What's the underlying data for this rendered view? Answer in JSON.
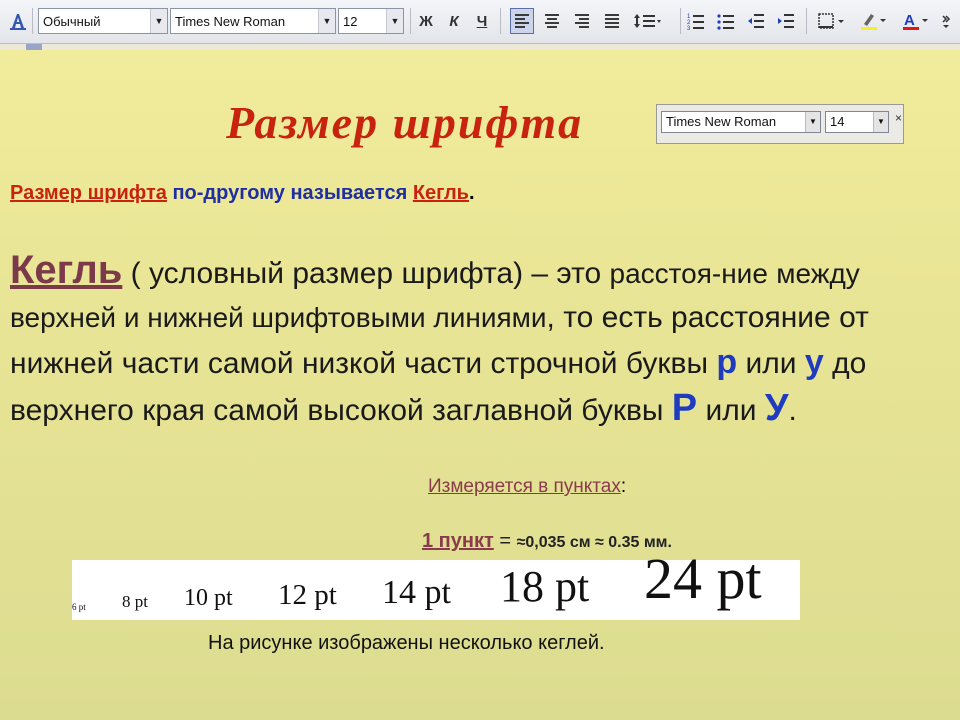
{
  "toolbar": {
    "style_value": "Обычный",
    "font_value": "Times New Roman",
    "size_value": "12",
    "bold_label": "Ж",
    "italic_label": "К",
    "underline_label": "Ч"
  },
  "slide": {
    "title": "Размер шрифта",
    "minibar": {
      "font_value": "Times New Roman",
      "size_value": "14"
    },
    "line1": {
      "term": "Размер шрифта",
      "middle": " по-другому называется ",
      "kegl": "Кегль",
      "end": "."
    },
    "definition": {
      "term": "Кегль",
      "part1": " ( условный размер шрифта) – это ",
      "part1_small": "расстоя-ние",
      "part2": "между верхней и нижней шрифтовыми линиями",
      "part3": ", то есть расстояние от нижней части самой низкой части строчной буквы ",
      "lower_p": "р",
      "or1": " или ",
      "lower_u": "у",
      "part4": " до верхнего края самой высокой заглавной буквы ",
      "upper_p": "Р",
      "or2": " или ",
      "upper_u": "У",
      "end": "."
    },
    "measured": {
      "link": "Измеряется в пунктах",
      "colon": ":"
    },
    "point": {
      "label": "1 пункт",
      "eq": " = ",
      "value": "≈0,035 см ≈ 0.35 мм."
    },
    "sizes": [
      "6 pt",
      "8 pt",
      "10 pt",
      "12 pt",
      "14 pt",
      "18 pt",
      "24 pt"
    ],
    "caption": "На рисунке изображены несколько кеглей."
  }
}
